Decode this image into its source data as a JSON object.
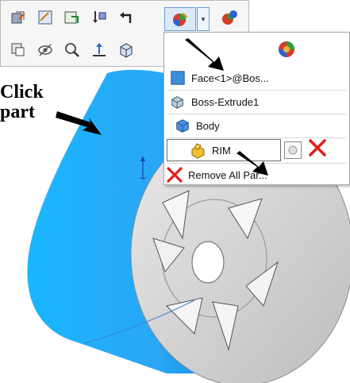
{
  "annotation": {
    "line1": "Click",
    "line2": "part"
  },
  "toolbar": {
    "buttons": [
      "edit-appearance-icon",
      "sketch-icon",
      "instant3d-icon",
      "sort-icon",
      "back-icon",
      "appearance-icon",
      "copy-icon",
      "hide-icon",
      "zoom-icon",
      "normal-to-icon",
      "view-orientation-icon"
    ]
  },
  "menu": {
    "items": [
      {
        "label": "Face<1>@Bos...",
        "icon": "face-icon"
      },
      {
        "label": "Boss-Extrude1",
        "icon": "feature-icon"
      },
      {
        "label": "Body",
        "icon": "body-icon"
      },
      {
        "label": "RIM",
        "icon": "part-icon"
      },
      {
        "label": "Remove All ...ar...",
        "icon": "remove-icon"
      }
    ],
    "remove_all_label": "Remove All Par..."
  },
  "colors": {
    "face_highlight": "#1aa8ff",
    "part_gray": "#cfcfcf",
    "remove_red": "#e21c1c"
  }
}
